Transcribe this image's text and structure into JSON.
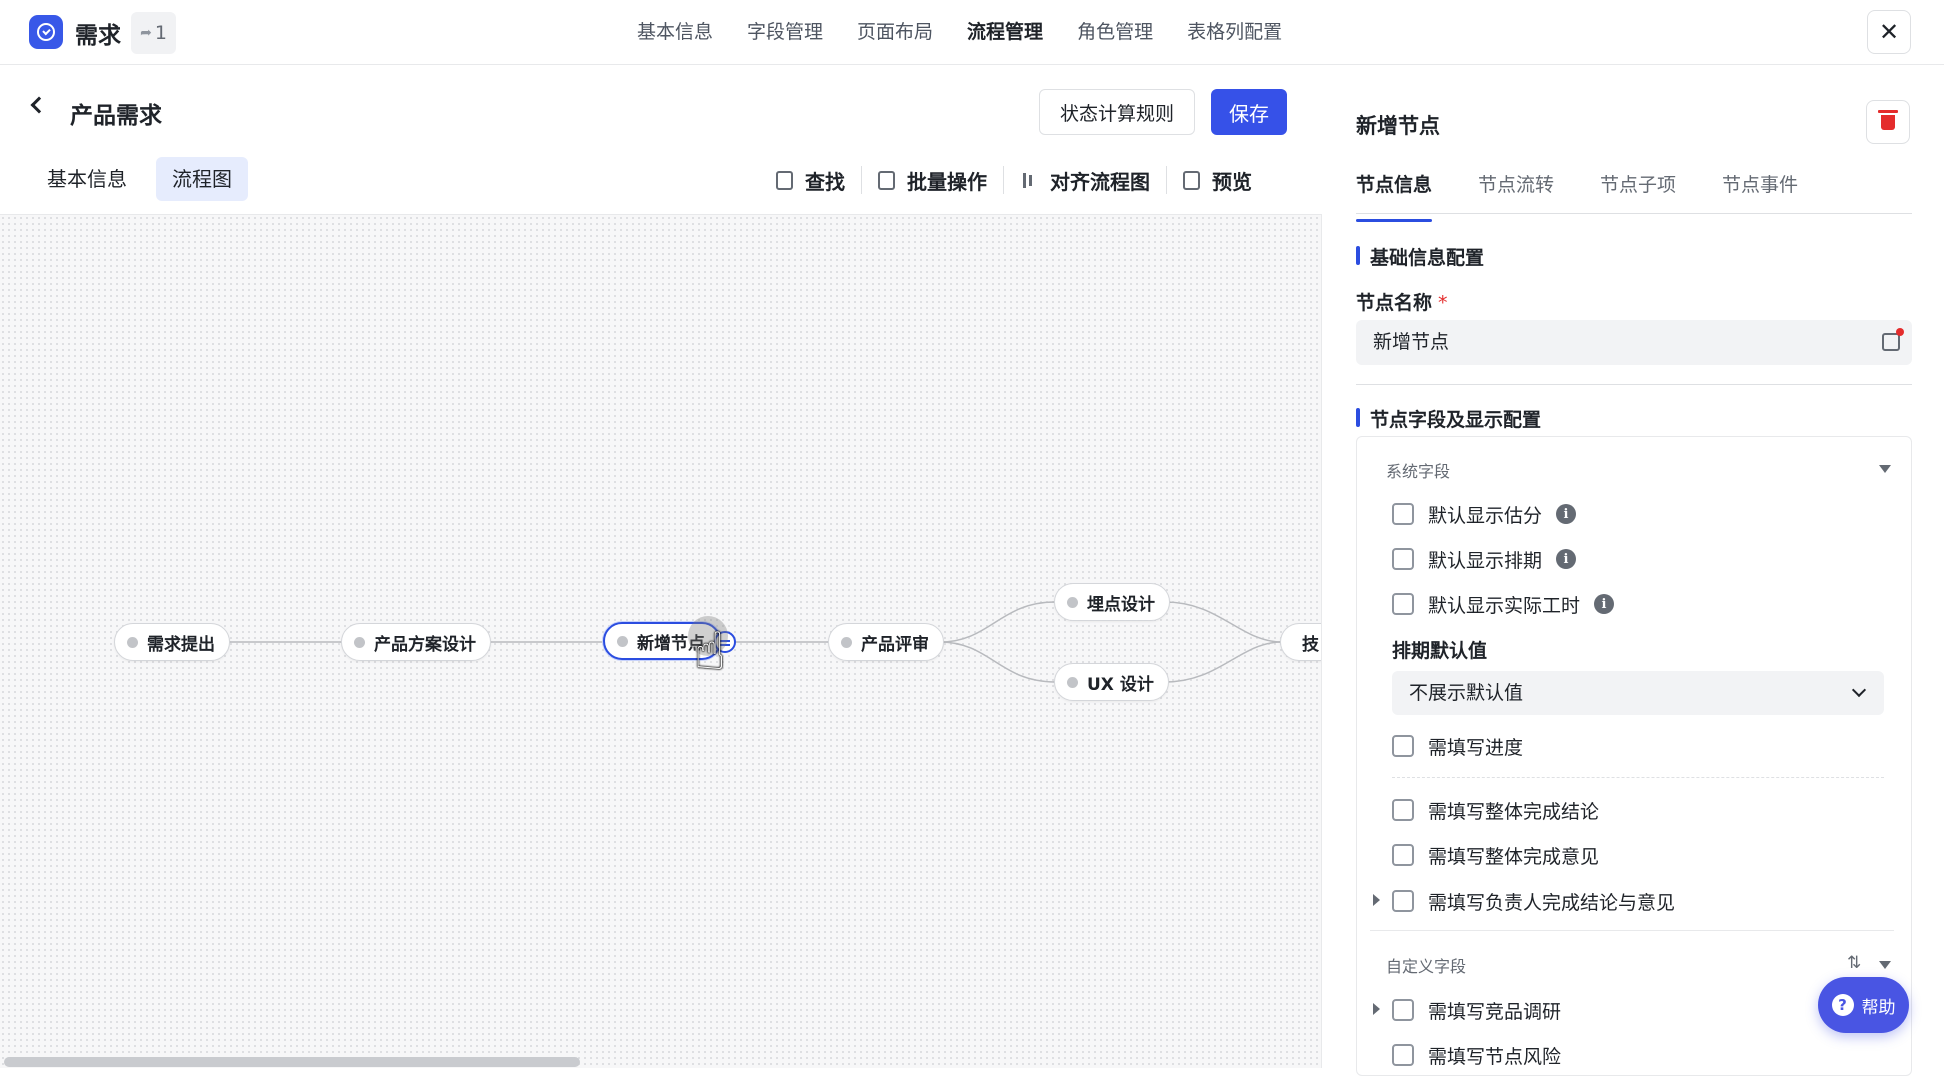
{
  "app": {
    "title": "需求",
    "share_count": "1"
  },
  "top_nav": {
    "items": [
      "基本信息",
      "字段管理",
      "页面布局",
      "流程管理",
      "角色管理",
      "表格列配置"
    ],
    "active": "流程管理"
  },
  "header": {
    "title": "产品需求",
    "rule_button": "状态计算规则",
    "save_button": "保存"
  },
  "sub_tabs": {
    "basic": "基本信息",
    "flow": "流程图"
  },
  "toolbar": {
    "find": "查找",
    "batch": "批量操作",
    "align": "对齐流程图",
    "preview": "预览"
  },
  "flow": {
    "nodes": [
      {
        "id": "n1",
        "label": "需求提出"
      },
      {
        "id": "n2",
        "label": "产品方案设计"
      },
      {
        "id": "n3",
        "label": "新增节点",
        "selected": true
      },
      {
        "id": "n4",
        "label": "产品评审"
      },
      {
        "id": "n5",
        "label": "埋点设计"
      },
      {
        "id": "n6",
        "label": "UX 设计"
      },
      {
        "id": "n7",
        "label": "技"
      }
    ],
    "edges": [
      [
        "n1",
        "n2"
      ],
      [
        "n2",
        "n3"
      ],
      [
        "n3",
        "n4"
      ],
      [
        "n4",
        "n5"
      ],
      [
        "n4",
        "n6"
      ],
      [
        "n5",
        "n7"
      ],
      [
        "n6",
        "n7"
      ]
    ]
  },
  "panel": {
    "title": "新增节点",
    "tabs": [
      "节点信息",
      "节点流转",
      "节点子项",
      "节点事件"
    ],
    "active_tab": "节点信息",
    "basic_section": "基础信息配置",
    "name_label": "节点名称",
    "required_mark": "*",
    "name_value": "新增节点",
    "fields_section": "节点字段及显示配置",
    "system_group": "系统字段",
    "sys_fields": {
      "estimate": "默认显示估分",
      "schedule": "默认显示排期",
      "actual_hours": "默认显示实际工时"
    },
    "schedule_default_label": "排期默认值",
    "schedule_default_value": "不展示默认值",
    "progress": "需填写进度",
    "overall_conclusion": "需填写整体完成结论",
    "overall_opinion": "需填写整体完成意见",
    "owner_conclusion": "需填写负责人完成结论与意见",
    "custom_group": "自定义字段",
    "custom_fields": {
      "competitor": "需填写竞品调研",
      "risk": "需填写节点风险"
    },
    "help": "帮助"
  },
  "colors": {
    "primary": "#3651e8",
    "danger": "#e42c2c",
    "selected_border": "#2b4de0"
  }
}
